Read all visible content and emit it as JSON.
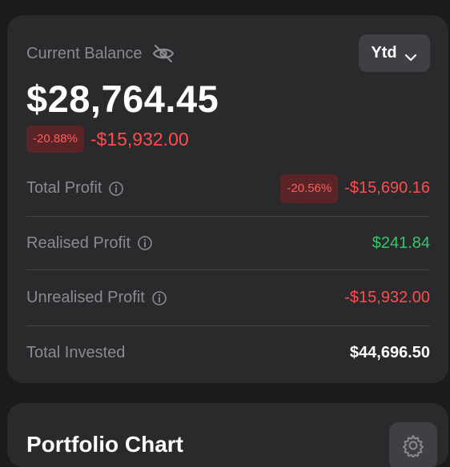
{
  "balance_card": {
    "label": "Current Balance",
    "period_selector": "Ytd",
    "balance": "$28,764.45",
    "change_percent": "-20.88%",
    "change_amount": "-$15,932.00",
    "colors": {
      "negative": "#ff4d4d",
      "positive": "#35c76a",
      "card_bg": "#2a2a2d"
    }
  },
  "rows": [
    {
      "label": "Total Profit",
      "has_info_icon": true,
      "badge": "-20.56%",
      "value": "-$15,690.16",
      "tone": "negative"
    },
    {
      "label": "Realised Profit",
      "has_info_icon": true,
      "value": "$241.84",
      "tone": "positive"
    },
    {
      "label": "Unrealised Profit",
      "has_info_icon": true,
      "value": "-$15,932.00",
      "tone": "negative"
    },
    {
      "label": "Total Invested",
      "has_info_icon": false,
      "value": "$44,696.50",
      "tone": "neutral"
    }
  ],
  "chart_card": {
    "title": "Portfolio Chart",
    "settings_icon": "gear-icon"
  }
}
